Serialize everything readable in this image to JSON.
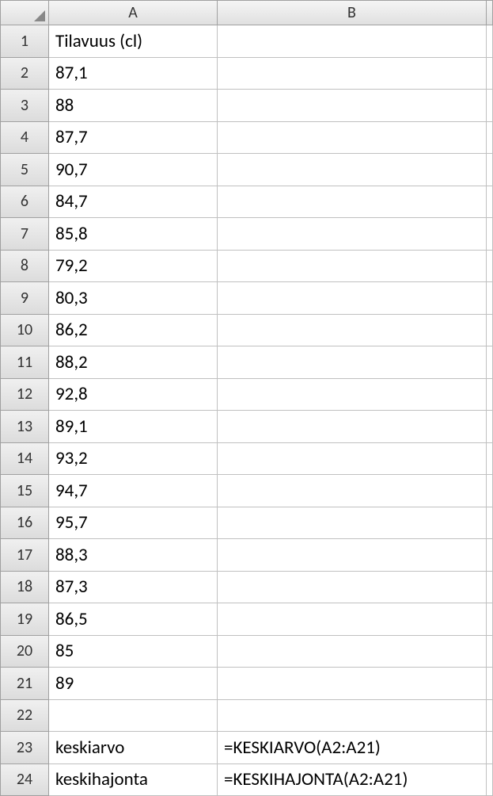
{
  "columns": [
    "A",
    "B"
  ],
  "rowCount": 24,
  "cells": {
    "A1": "Tilavuus (cl)",
    "A2": "87,1",
    "A3": "88",
    "A4": "87,7",
    "A5": "90,7",
    "A6": "84,7",
    "A7": "85,8",
    "A8": "79,2",
    "A9": "80,3",
    "A10": "86,2",
    "A11": "88,2",
    "A12": "92,8",
    "A13": "89,1",
    "A14": "93,2",
    "A15": "94,7",
    "A16": "95,7",
    "A17": "88,3",
    "A18": "87,3",
    "A19": "86,5",
    "A20": "85",
    "A21": "89",
    "A22": "",
    "A23": "keskiarvo",
    "A24": "keskihajonta",
    "B1": "",
    "B2": "",
    "B3": "",
    "B4": "",
    "B5": "",
    "B6": "",
    "B7": "",
    "B8": "",
    "B9": "",
    "B10": "",
    "B11": "",
    "B12": "",
    "B13": "",
    "B14": "",
    "B15": "",
    "B16": "",
    "B17": "",
    "B18": "",
    "B19": "",
    "B20": "",
    "B21": "",
    "B22": "",
    "B23": "=KESKIARVO(A2:A21)",
    "B24": "=KESKIHAJONTA(A2:A21)"
  },
  "chart_data": {
    "type": "table",
    "title": "Tilavuus (cl)",
    "values": [
      87.1,
      88,
      87.7,
      90.7,
      84.7,
      85.8,
      79.2,
      80.3,
      86.2,
      88.2,
      92.8,
      89.1,
      93.2,
      94.7,
      95.7,
      88.3,
      87.3,
      86.5,
      85,
      89
    ],
    "summary": [
      {
        "label": "keskiarvo",
        "formula": "=KESKIARVO(A2:A21)"
      },
      {
        "label": "keskihajonta",
        "formula": "=KESKIHAJONTA(A2:A21)"
      }
    ]
  }
}
